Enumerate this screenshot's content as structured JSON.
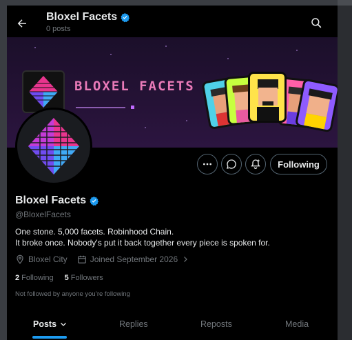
{
  "header": {
    "title": "Bloxel Facets",
    "post_count": "0 posts"
  },
  "banner": {
    "text": "BLOXEL FACETS"
  },
  "profile": {
    "name": "Bloxel Facets",
    "handle": "@BloxelFacets",
    "bio_line1": "One stone. 5,000 facets. Robinhood Chain.",
    "bio_line2": "It broke once. Nobody's put it back together every piece is spoken for.",
    "location": "Bloxel City",
    "joined": "Joined September 2026",
    "following_count": "2",
    "following_label": "Following",
    "followers_count": "5",
    "followers_label": "Followers",
    "not_followed": "Not followed by anyone you’re following"
  },
  "actions": {
    "following_label": "Following"
  },
  "tabs": [
    {
      "label": "Posts",
      "active": true
    },
    {
      "label": "Replies",
      "active": false
    },
    {
      "label": "Reposts",
      "active": false
    },
    {
      "label": "Media",
      "active": false
    }
  ],
  "colors": {
    "accent": "#1d9bf0",
    "verified": "#1d9bf0",
    "muted": "#71767b",
    "background": "#000000",
    "banner_bg": "#251236",
    "diamond_pink": "#e8358e",
    "diamond_blue": "#3fa9f5"
  },
  "icons": [
    "back-arrow-icon",
    "search-icon",
    "verified-icon",
    "more-icon",
    "message-icon",
    "notification-bell-icon",
    "location-icon",
    "calendar-icon",
    "chevron-right-icon",
    "chevron-down-icon"
  ]
}
